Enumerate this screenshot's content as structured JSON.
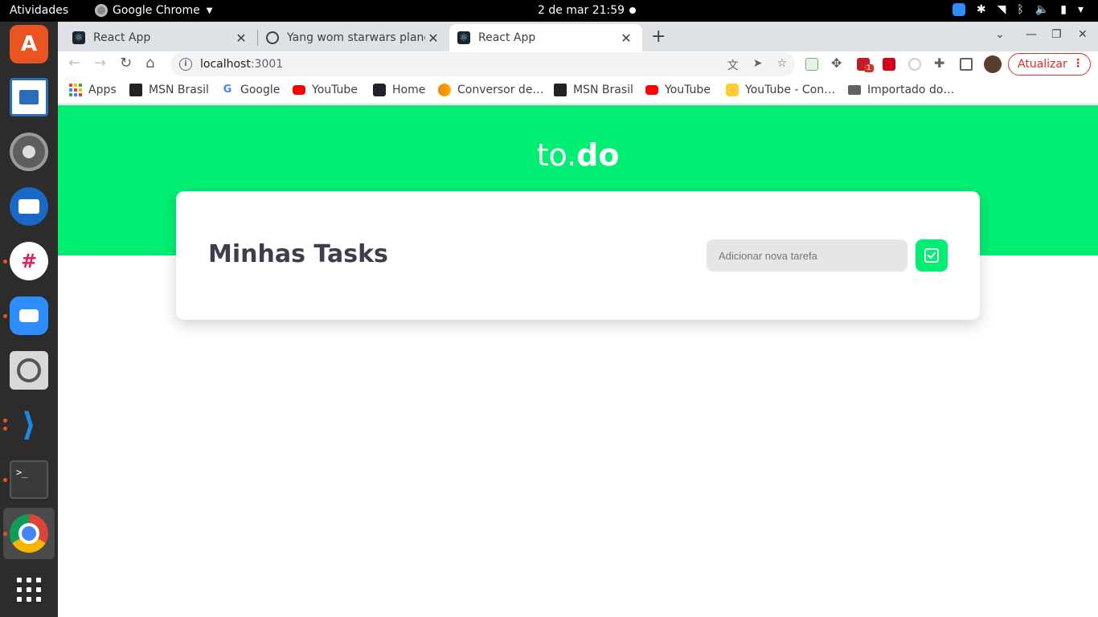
{
  "system": {
    "activities_label": "Atividades",
    "app_name": "Google Chrome",
    "clock": "2 de mar  21:59"
  },
  "dock": {
    "items": [
      "ubuntu-software",
      "libreoffice-writer",
      "settings",
      "thunderbird",
      "slack",
      "zoom",
      "image-viewer",
      "vscode",
      "terminal",
      "chrome",
      "show-applications"
    ]
  },
  "browser": {
    "tabs": [
      {
        "label": "React App",
        "active": false
      },
      {
        "label": "Yang wom starwars plane",
        "active": false
      },
      {
        "label": "React App",
        "active": true
      }
    ],
    "url_host": "localhost",
    "url_port": ":3001",
    "update_label": "Atualizar",
    "bookmarks": [
      {
        "label": "Apps",
        "icon": "apps-grid-icon"
      },
      {
        "label": "MSN Brasil",
        "icon": "msn-icon"
      },
      {
        "label": "Google",
        "icon": "google-icon"
      },
      {
        "label": "YouTube",
        "icon": "youtube-icon"
      },
      {
        "label": "Home",
        "icon": "react-icon"
      },
      {
        "label": "Conversor de…",
        "icon": "converter-icon"
      },
      {
        "label": "MSN Brasil",
        "icon": "msn-icon"
      },
      {
        "label": "YouTube",
        "icon": "youtube-icon"
      },
      {
        "label": "YouTube - Con…",
        "icon": "youtube-con-icon"
      },
      {
        "label": "Importado do…",
        "icon": "folder-icon"
      }
    ],
    "extension_badge": "1"
  },
  "app": {
    "brand_light": "to.",
    "brand_bold": "do",
    "title": "Minhas Tasks",
    "input_placeholder": "Adicionar nova tarefa",
    "input_value": "",
    "accent_color": "#00ef73"
  }
}
